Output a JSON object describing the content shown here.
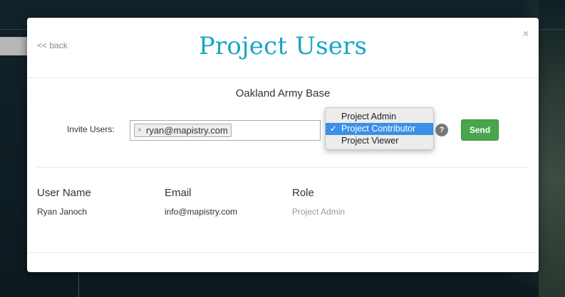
{
  "modal": {
    "back_label": "<< back",
    "close_label": "×",
    "title": "Project Users",
    "project_name": "Oakland Army Base"
  },
  "invite": {
    "label": "Invite Users:",
    "tags": [
      {
        "email": "ryan@mapistry.com",
        "remove": "×"
      }
    ],
    "role_options": [
      {
        "label": "Project Admin",
        "selected": false
      },
      {
        "label": "Project Contributor",
        "selected": true
      },
      {
        "label": "Project Viewer",
        "selected": false
      }
    ],
    "checkmark": "✓",
    "help_label": "?",
    "send_label": "Send"
  },
  "users_table": {
    "headers": [
      "User Name",
      "Email",
      "Role"
    ],
    "rows": [
      {
        "name": "Ryan Janoch",
        "email": "info@mapistry.com",
        "role": "Project Admin"
      }
    ]
  },
  "colors": {
    "title": "#16a6c4",
    "send_button": "#48a64c",
    "selected_option": "#3b8fe8"
  }
}
